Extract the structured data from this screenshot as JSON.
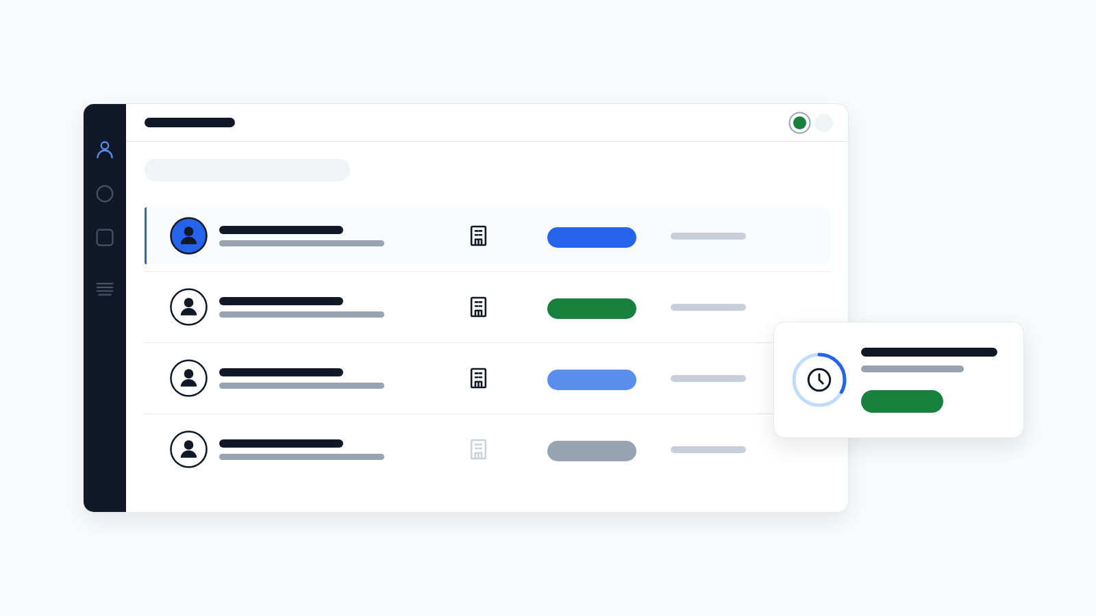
{
  "sidebar": {
    "items": [
      {
        "kind": "user",
        "selected": true
      },
      {
        "kind": "circle",
        "selected": false
      },
      {
        "kind": "square",
        "selected": false
      },
      {
        "kind": "lines",
        "selected": false
      }
    ]
  },
  "header": {
    "status_dots": [
      {
        "selected": true
      },
      {
        "selected": false
      }
    ]
  },
  "rows": [
    {
      "selected": true,
      "disabled": false,
      "color": "#2563eb"
    },
    {
      "selected": false,
      "disabled": false,
      "color": "#18803d"
    },
    {
      "selected": false,
      "disabled": false,
      "color": "#5b8def"
    },
    {
      "selected": false,
      "disabled": true,
      "color": "#98a3b3"
    }
  ],
  "popup_card": {
    "progress": {
      "level": 0.33
    }
  }
}
